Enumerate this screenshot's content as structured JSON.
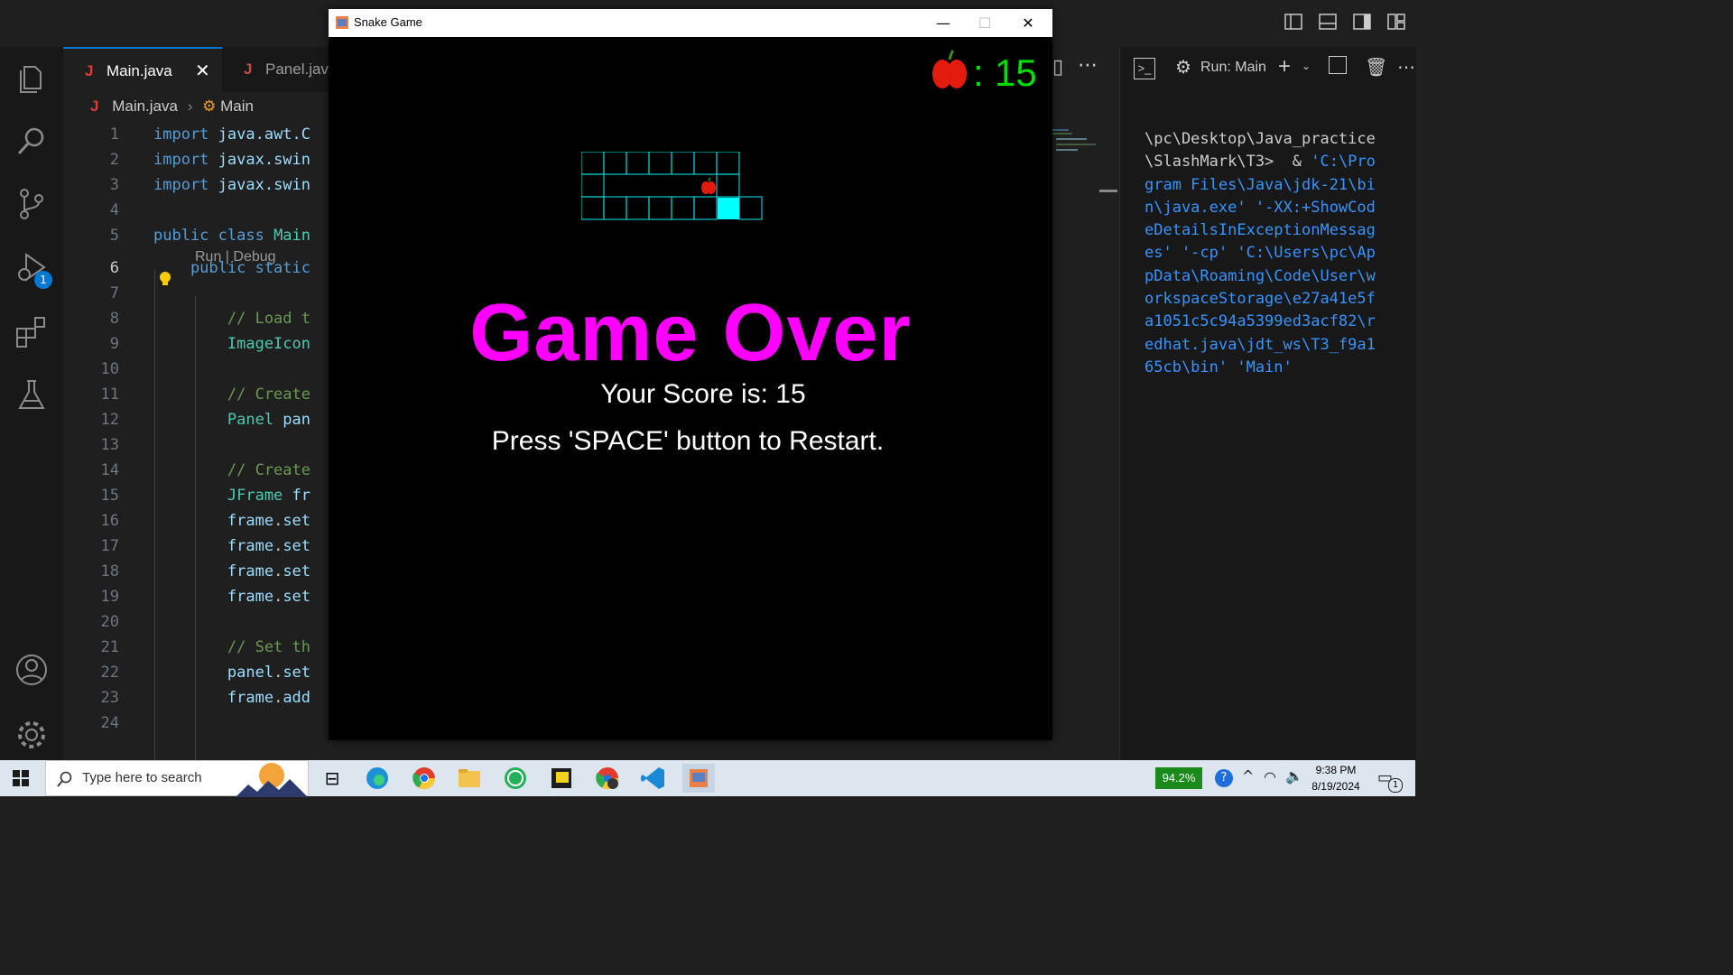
{
  "editor": {
    "tabs": [
      {
        "label": "Main.java",
        "icon": "J"
      },
      {
        "label": "Panel.jav",
        "icon": "J"
      }
    ],
    "breadcrumb": {
      "file": "Main.java",
      "symbol": "Main"
    },
    "codelens": "Run | Debug",
    "lines": [
      {
        "n": "1",
        "parts": [
          [
            "kw",
            "import "
          ],
          [
            "id",
            "java.awt.C"
          ]
        ]
      },
      {
        "n": "2",
        "parts": [
          [
            "kw",
            "import "
          ],
          [
            "id",
            "javax.swin"
          ]
        ]
      },
      {
        "n": "3",
        "parts": [
          [
            "kw",
            "import "
          ],
          [
            "id",
            "javax.swin"
          ]
        ]
      },
      {
        "n": "4",
        "parts": []
      },
      {
        "n": "5",
        "parts": [
          [
            "kw",
            "public class "
          ],
          [
            "ty",
            "Main"
          ]
        ]
      },
      {
        "n": "6",
        "parts": [
          [
            "kw",
            "    public static"
          ]
        ],
        "current": true
      },
      {
        "n": "7",
        "parts": []
      },
      {
        "n": "8",
        "parts": [
          [
            "cm",
            "        // Load t"
          ]
        ]
      },
      {
        "n": "9",
        "parts": [
          [
            "ty",
            "        ImageIcon"
          ]
        ]
      },
      {
        "n": "10",
        "parts": []
      },
      {
        "n": "11",
        "parts": [
          [
            "cm",
            "        // Create"
          ]
        ]
      },
      {
        "n": "12",
        "parts": [
          [
            "ty",
            "        Panel "
          ],
          [
            "id",
            "pan"
          ]
        ]
      },
      {
        "n": "13",
        "parts": []
      },
      {
        "n": "14",
        "parts": [
          [
            "cm",
            "        // Create"
          ]
        ]
      },
      {
        "n": "15",
        "parts": [
          [
            "ty",
            "        JFrame "
          ],
          [
            "id",
            "fr"
          ]
        ]
      },
      {
        "n": "16",
        "parts": [
          [
            "id",
            "        frame"
          ],
          [
            "tx",
            "."
          ],
          [
            "id",
            "set"
          ]
        ]
      },
      {
        "n": "17",
        "parts": [
          [
            "id",
            "        frame"
          ],
          [
            "tx",
            "."
          ],
          [
            "id",
            "set"
          ]
        ]
      },
      {
        "n": "18",
        "parts": [
          [
            "id",
            "        frame"
          ],
          [
            "tx",
            "."
          ],
          [
            "id",
            "set"
          ]
        ]
      },
      {
        "n": "19",
        "parts": [
          [
            "id",
            "        frame"
          ],
          [
            "tx",
            "."
          ],
          [
            "id",
            "set"
          ]
        ]
      },
      {
        "n": "20",
        "parts": []
      },
      {
        "n": "21",
        "parts": [
          [
            "cm",
            "        // Set th"
          ]
        ]
      },
      {
        "n": "22",
        "parts": [
          [
            "id",
            "        panel"
          ],
          [
            "tx",
            "."
          ],
          [
            "id",
            "set"
          ]
        ]
      },
      {
        "n": "23",
        "parts": [
          [
            "id",
            "        frame"
          ],
          [
            "tx",
            "."
          ],
          [
            "id",
            "add"
          ]
        ]
      },
      {
        "n": "24",
        "parts": []
      }
    ]
  },
  "terminal": {
    "header": "Run: Main",
    "text_plain": "\\pc\\Desktop\\Java_practice\\SlashMark\\T3>  & ",
    "text_blue": "'C:\\Program Files\\Java\\jdk-21\\bin\\java.exe' '-XX:+ShowCodeDetailsInExceptionMessages' '-cp' 'C:\\Users\\pc\\AppData\\Roaming\\Code\\User\\workspaceStorage\\e27a41e5fa1051c5c94a5399ed3acf82\\redhat.java\\jdt_ws\\T3_f9a165cb\\bin' 'Main'"
  },
  "game": {
    "window_title": "Snake Game",
    "score_value": "15",
    "score_colon": ":",
    "game_over": "Game Over",
    "your_score": "Your Score is: 15",
    "restart": "Press 'SPACE' button to Restart.",
    "snake_color": "#00ffff",
    "text_color": "#ff00ff",
    "score_color": "#00e000"
  },
  "activity_bar": {
    "debug_badge": "1",
    "icons": [
      "explorer-icon",
      "search-icon",
      "source-control-icon",
      "run-debug-icon",
      "extensions-icon",
      "testing-icon",
      "accounts-icon",
      "settings-gear-icon"
    ]
  },
  "taskbar": {
    "search_placeholder": "Type here to search",
    "battery": "94.2%",
    "time": "9:38 PM",
    "date": "8/19/2024",
    "notification_count": "1"
  },
  "colors": {
    "accent": "#0078d4",
    "java_icon": "#e53935"
  }
}
